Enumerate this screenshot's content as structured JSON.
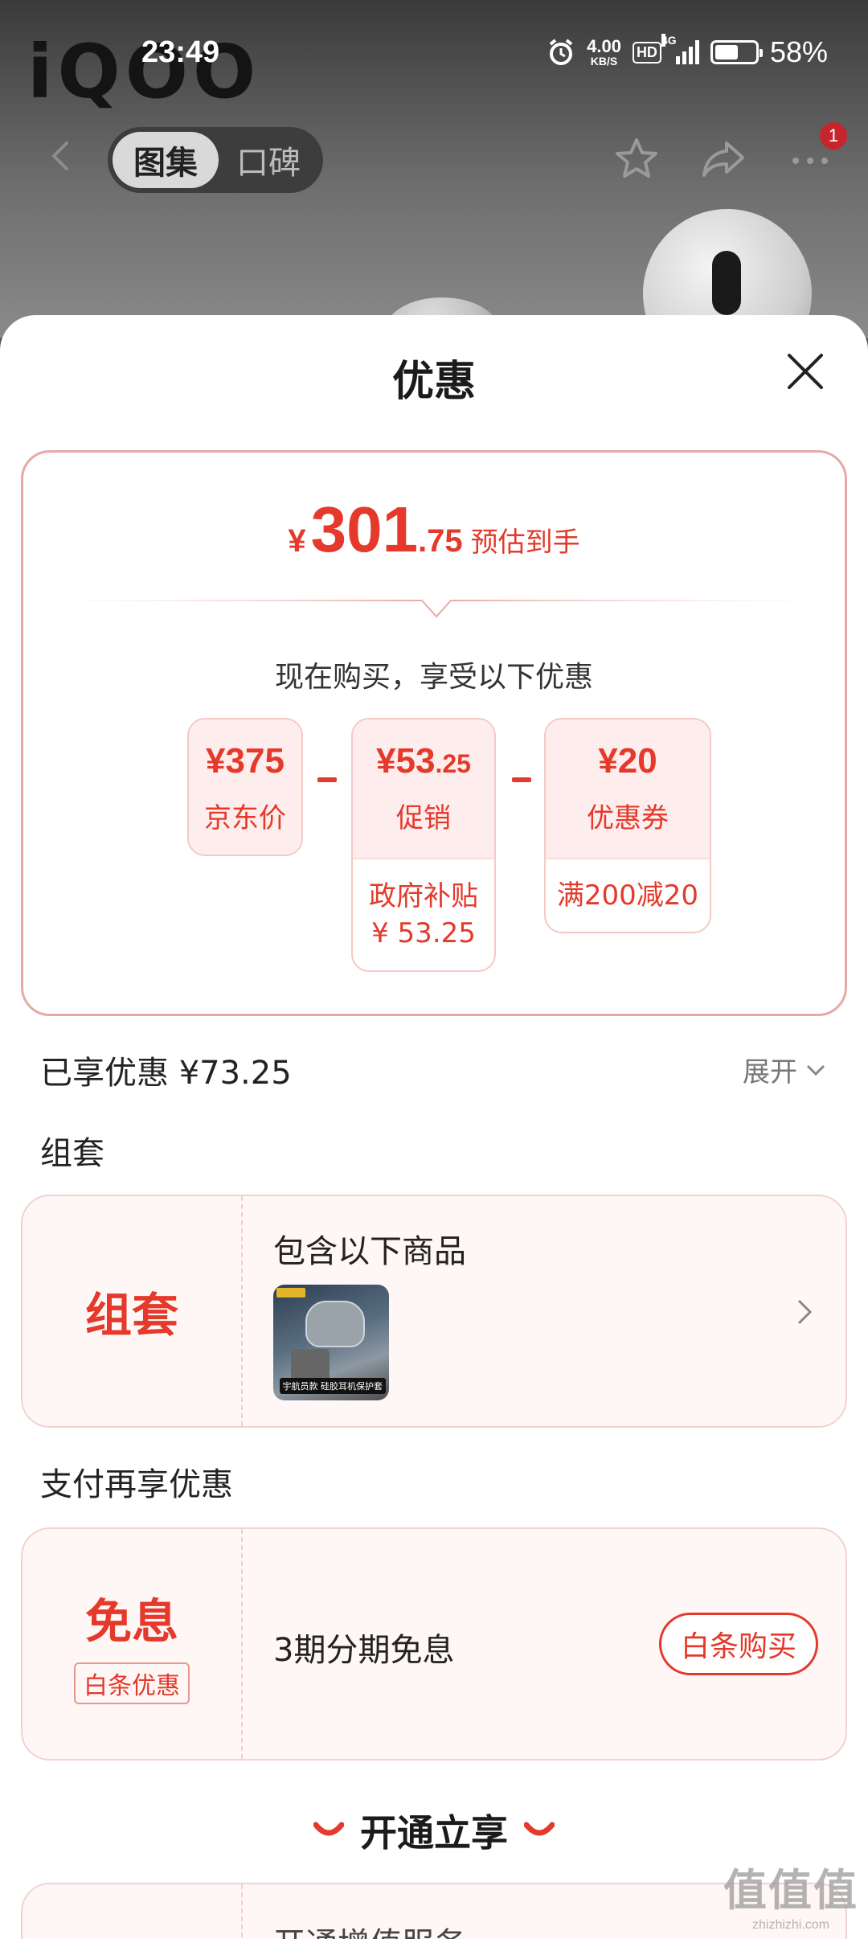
{
  "status_bar": {
    "time": "23:49",
    "net_speed_value": "4.00",
    "net_speed_unit": "KB/S",
    "hd_label": "HD",
    "signal_label": "4G",
    "battery_percent": "58%",
    "battery_level": 0.58
  },
  "background": {
    "brand_logo": "iQOO"
  },
  "nav": {
    "tabs": [
      {
        "label": "图集",
        "active": true
      },
      {
        "label": "口碑",
        "active": false
      }
    ],
    "notification_badge": "1"
  },
  "sheet": {
    "title": "优惠",
    "estimate": {
      "currency": "¥",
      "integer": "301",
      "decimal": ".75",
      "label": "预估到手"
    },
    "subtitle": "现在购买，享受以下优惠",
    "breakdown": [
      {
        "value_main": "¥375",
        "value_small": "",
        "label": "京东价",
        "detail_lines": []
      },
      {
        "value_main": "¥53",
        "value_small": ".25",
        "label": "促销",
        "detail_lines": [
          "政府补贴",
          "¥ 53.25"
        ]
      },
      {
        "value_main": "¥20",
        "value_small": "",
        "label": "优惠券",
        "detail_lines": [
          "满200减20"
        ]
      }
    ],
    "saved_text": "已享优惠 ¥73.25",
    "expand_label": "展开",
    "bundle_section": {
      "heading": "组套",
      "card_title": "组套",
      "card_text": "包含以下商品",
      "thumb_caption": "宇航员款 硅胶耳机保护套"
    },
    "payment_section": {
      "heading": "支付再享优惠",
      "card_title": "免息",
      "card_tag": "白条优惠",
      "card_text": "3期分期免息",
      "button_label": "白条购买"
    },
    "open_heading": "开通立享",
    "partial_card_text": "开通增值服务"
  },
  "watermark": {
    "big": "值值值",
    "small": "zhizhizhi.com"
  },
  "colors": {
    "accent": "#e4392b",
    "card_border": "#e6a9a6",
    "tile_bg": "#fdeeed",
    "promo_bg": "#fff7f6"
  }
}
